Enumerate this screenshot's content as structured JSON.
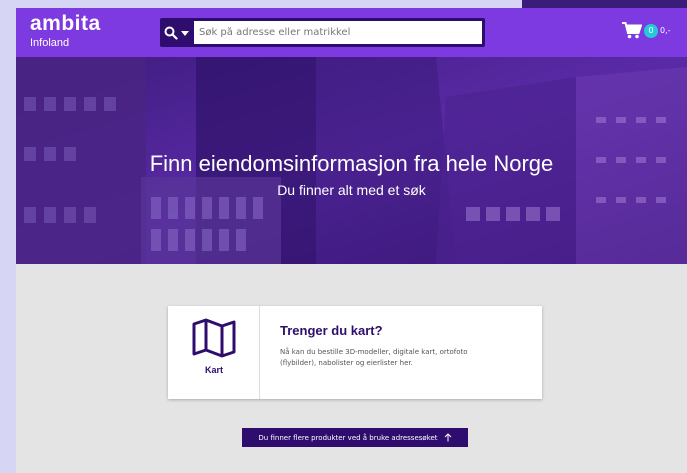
{
  "header": {
    "brand_name": "ambita",
    "brand_sub": "Infoland",
    "search": {
      "placeholder": "Søk på adresse eller matrikkel",
      "value": ""
    },
    "cart": {
      "count": "0",
      "amount": "0,-"
    }
  },
  "hero": {
    "title": "Finn eiendomsinformasjon fra hele Norge",
    "subtitle": "Du finner alt med et søk"
  },
  "product_card": {
    "icon_label": "Kart",
    "heading": "Trenger du kart?",
    "description": "Nå kan du bestille 3D-modeller, digitale kart, ortofoto (flybilder), nabolister og eierlister her."
  },
  "cta": {
    "label": "Du finner flere produkter ved å bruke adressesøket"
  },
  "colors": {
    "brand_purple": "#7c3ae0",
    "dark_purple": "#2e0d6e",
    "badge_teal": "#27c8d8",
    "page_bg": "#e4e4e4"
  },
  "icons": [
    "search-icon",
    "chevron-down-icon",
    "cart-icon",
    "map-icon",
    "arrow-up-icon"
  ]
}
